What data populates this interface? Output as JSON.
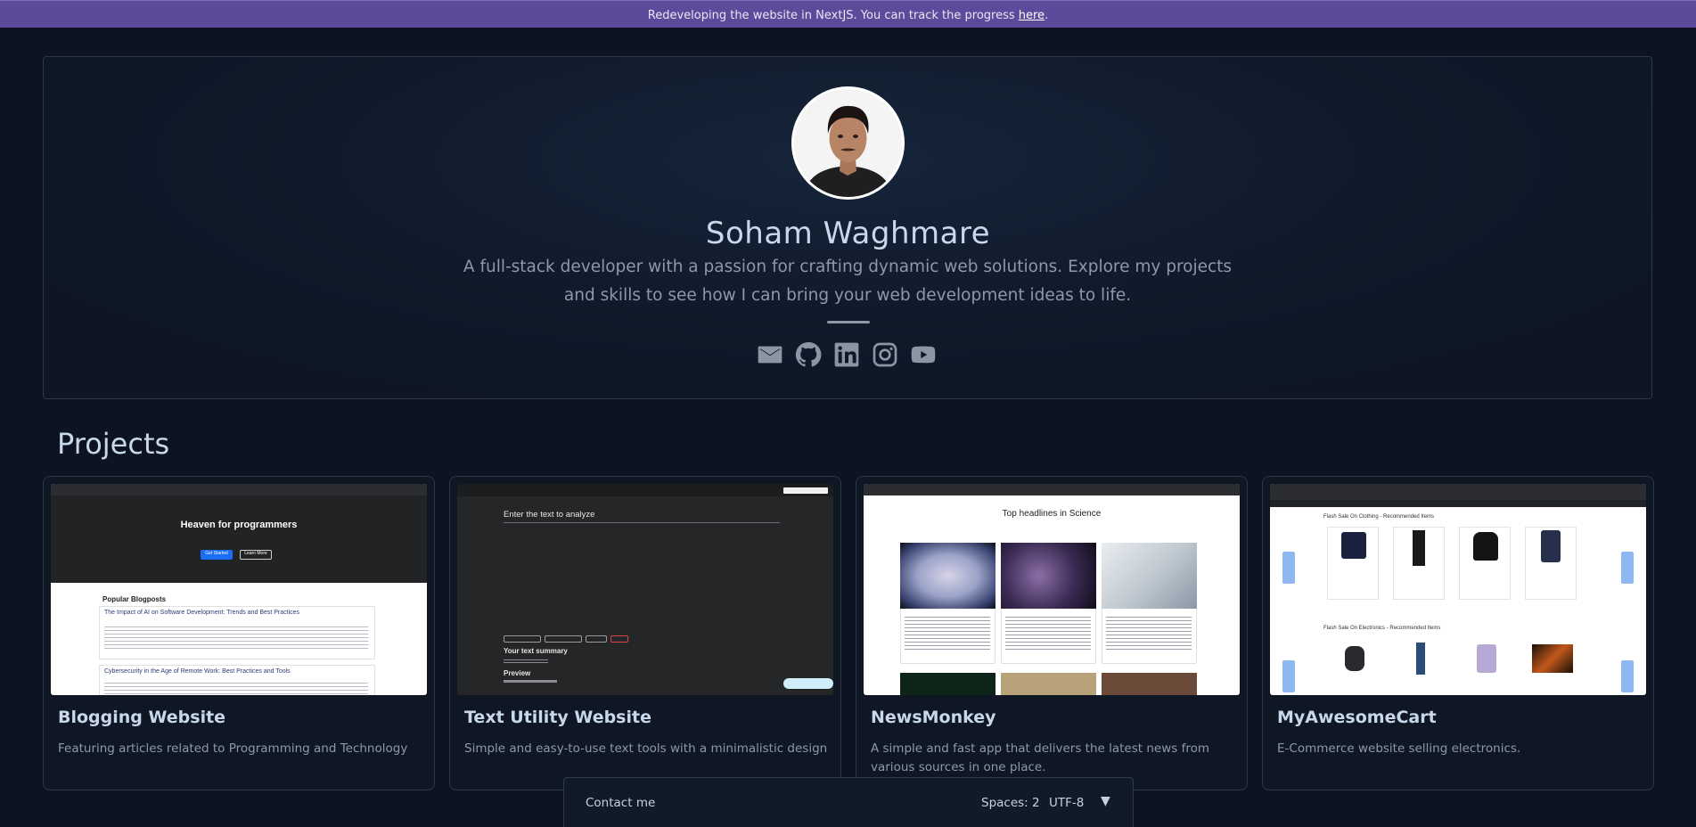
{
  "banner": {
    "text": "Redeveloping the website in NextJS. You can track the progress ",
    "link": "here",
    "suffix": "."
  },
  "profile": {
    "name": "Soham Waghmare",
    "tagline": "A full-stack developer with a passion for crafting dynamic web solutions. Explore my projects and skills to see how I can bring your web development ideas to life."
  },
  "socials": [
    {
      "icon": "mail-icon"
    },
    {
      "icon": "github-icon"
    },
    {
      "icon": "linkedin-icon"
    },
    {
      "icon": "instagram-icon"
    },
    {
      "icon": "youtube-icon"
    }
  ],
  "projects": {
    "title": "Projects",
    "items": [
      {
        "title": "Blogging Website",
        "description": "Featuring articles related to Programming and Technology",
        "thumb": {
          "hero_title": "Heaven for programmers",
          "get_started": "Get Started",
          "learn_more": "Learn More",
          "section": "Popular Blogposts",
          "post1": "The Impact of AI on Software Development: Trends and Best Practices",
          "post2": "Cybersecurity in the Age of Remote Work: Best Practices and Tools"
        }
      },
      {
        "title": "Text Utility Website",
        "description": "Simple and easy-to-use text tools with a minimalistic design",
        "thumb": {
          "heading": "Enter the text to analyze",
          "summary": "Your text summary",
          "preview": "Preview"
        }
      },
      {
        "title": "NewsMonkey",
        "description": "A simple and fast app that delivers the latest news from various sources in one place.",
        "thumb": {
          "heading": "Top headlines in Science"
        }
      },
      {
        "title": "MyAwesomeCart",
        "description": "E-Commerce website selling electronics.",
        "thumb": {
          "row1": "Flash Sale On Clothing - Recommended Items",
          "row2": "Flash Sale On Electronics - Recommended Items"
        }
      }
    ]
  },
  "bottom_bar": {
    "contact": "Contact me",
    "spaces": "Spaces: 2",
    "encoding": "UTF-8",
    "arrow": "▼"
  }
}
